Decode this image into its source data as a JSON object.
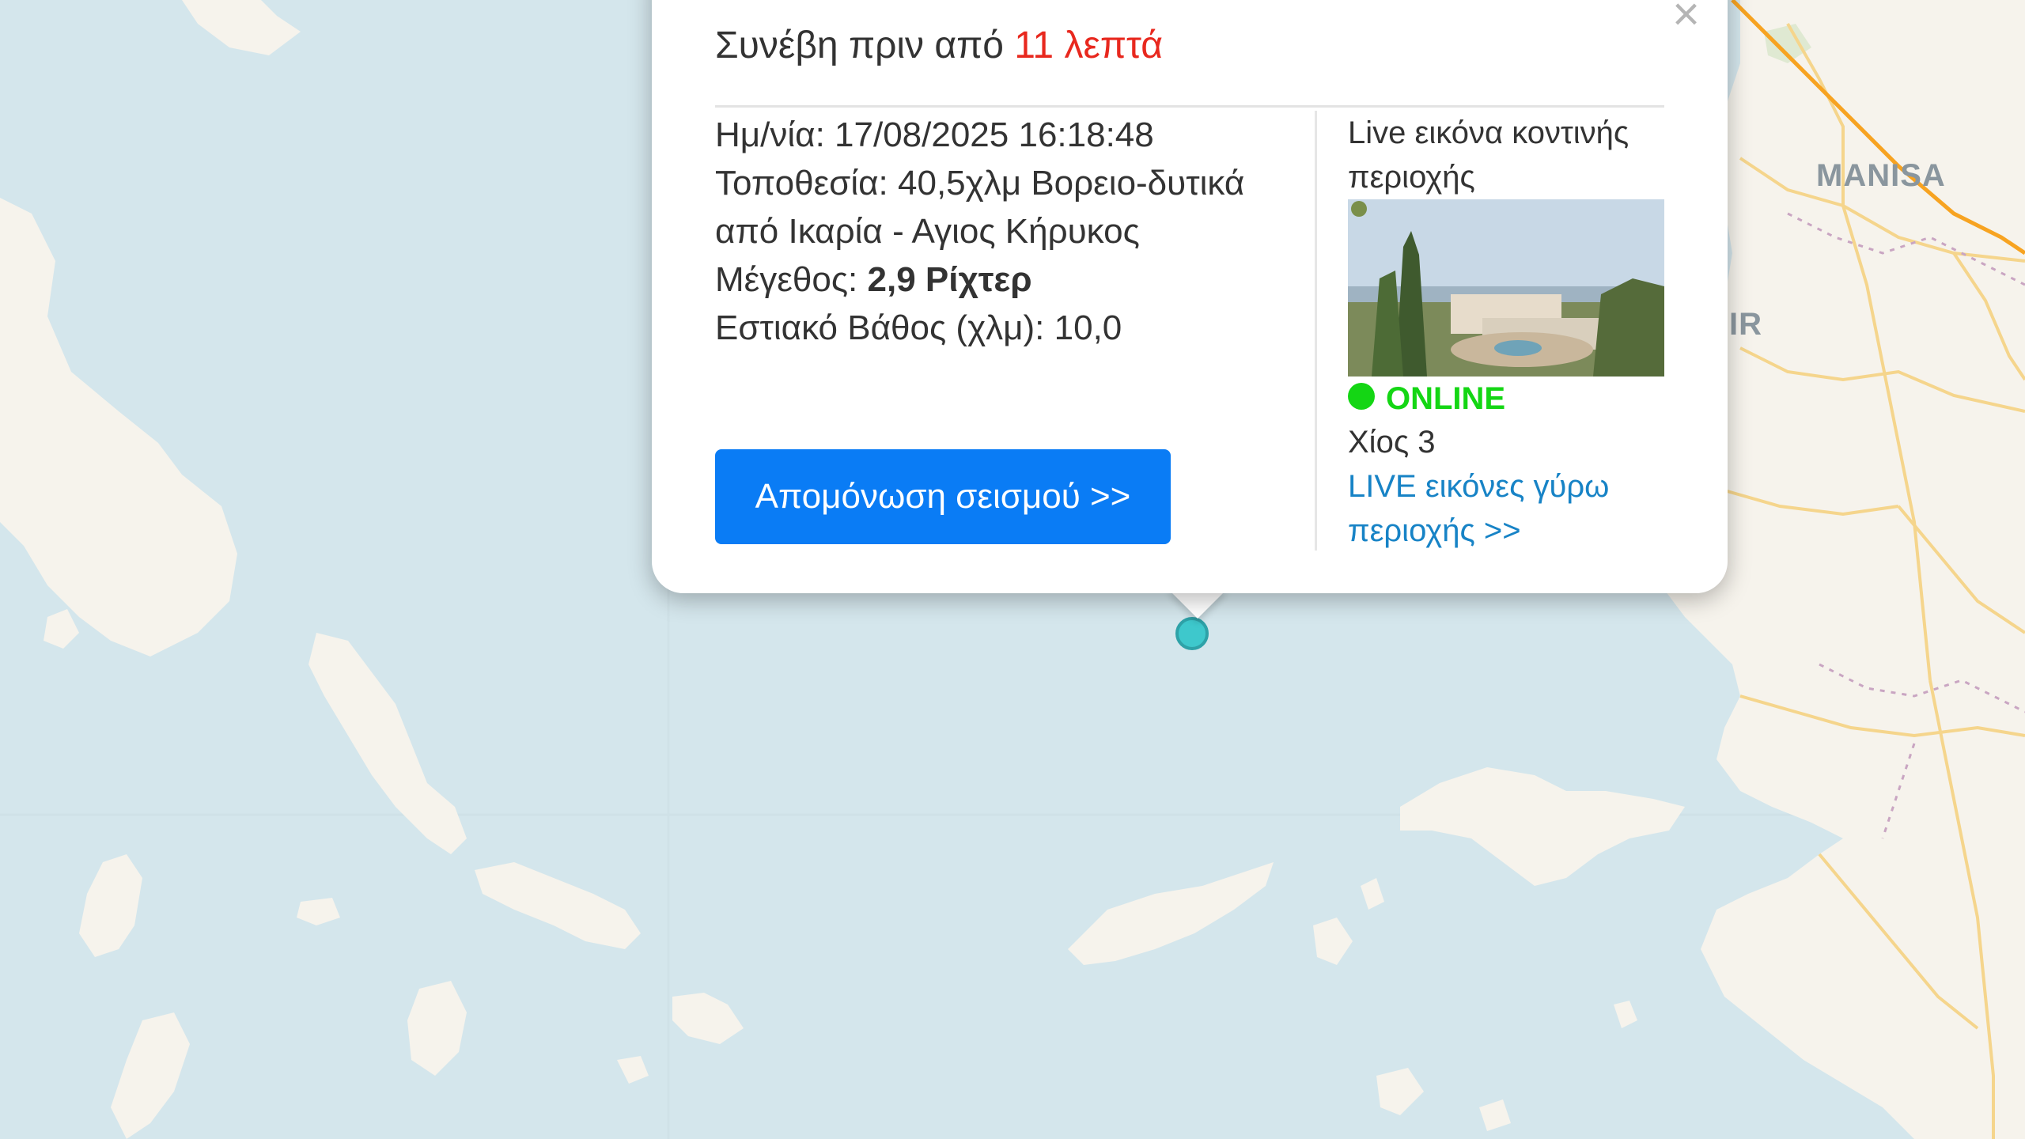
{
  "map": {
    "labels": {
      "manisa": "MANISA",
      "izmir_partial": "IR"
    },
    "colors": {
      "sea": "#d4e6ec",
      "land": "#f6f3ec",
      "road_major": "#f7a321",
      "road_minor": "#f5d58c",
      "border": "#c9a5c2"
    }
  },
  "popup": {
    "close_label": "×",
    "title_prefix": "Συνέβη πριν από ",
    "title_time_ago": "11 λεπτά",
    "date_label": "Ημ/νία:",
    "date_value": "17/08/2025 16:18:48",
    "location_label": "Τοποθεσία:",
    "location_value": "40,5χλμ Βορειο-δυτικά από Ικαρία - Αγιος Κήρυκος",
    "magnitude_label": "Μέγεθος:",
    "magnitude_value": "2,9 Ρίχτερ",
    "depth_label": "Εστιακό Βάθος (χλμ):",
    "depth_value": "10,0",
    "isolate_button": "Απομόνωση σεισμού >>",
    "live_title": "Live εικόνα κοντινής περιοχής",
    "webcam_status": "ONLINE",
    "webcam_name": "Χίος 3",
    "live_link": "LIVE εικόνες γύρω περιοχής >>",
    "colors": {
      "time_ago": "#e8281e",
      "button": "#0a7cf5",
      "online": "#14d614",
      "link": "#1783c6"
    }
  },
  "marker": {
    "icon": "earthquake-marker-icon",
    "color": "#3ec8cc"
  }
}
